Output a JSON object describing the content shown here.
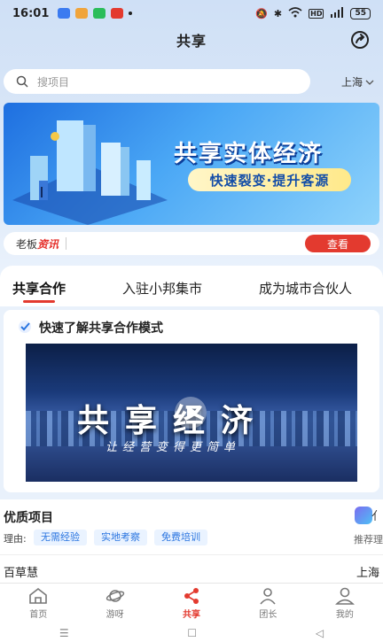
{
  "status": {
    "time": "16:01",
    "battery": "55",
    "network": "HD"
  },
  "header": {
    "title": "共享"
  },
  "search": {
    "placeholder": "搜项目",
    "city": "上海"
  },
  "banner": {
    "headline": "共享实体经济",
    "subline": "快速裂变·提升客源"
  },
  "news": {
    "label": "老板",
    "highlight": "资讯",
    "button": "查看"
  },
  "tabs": [
    {
      "label": "共享合作",
      "active": true
    },
    {
      "label": "入驻小邦集市",
      "active": false
    },
    {
      "label": "成为城市合伙人",
      "active": false
    }
  ],
  "video_card": {
    "title": "快速了解共享合作模式",
    "video_title": "共享经济",
    "video_subtitle": "让经营变得更简单"
  },
  "projects": {
    "heading": "优质项目",
    "reason_label": "理由:",
    "tags": [
      "无需经验",
      "实地考察",
      "免费培训"
    ],
    "right_label": "推荐理",
    "right_top": "亻",
    "item_name": "百草慧",
    "item_city": "上海"
  },
  "nav": [
    {
      "label": "首页",
      "icon": "home-icon"
    },
    {
      "label": "游呀",
      "icon": "planet-icon"
    },
    {
      "label": "共享",
      "icon": "share-icon",
      "active": true
    },
    {
      "label": "团长",
      "icon": "leader-icon"
    },
    {
      "label": "我的",
      "icon": "user-icon"
    }
  ],
  "sysbar": {
    "menu": "☰",
    "home": "☐",
    "back": "◁"
  },
  "colors": {
    "accent": "#e33a2f",
    "tag_bg": "#eaf3ff",
    "tag_text": "#2a75e0"
  }
}
